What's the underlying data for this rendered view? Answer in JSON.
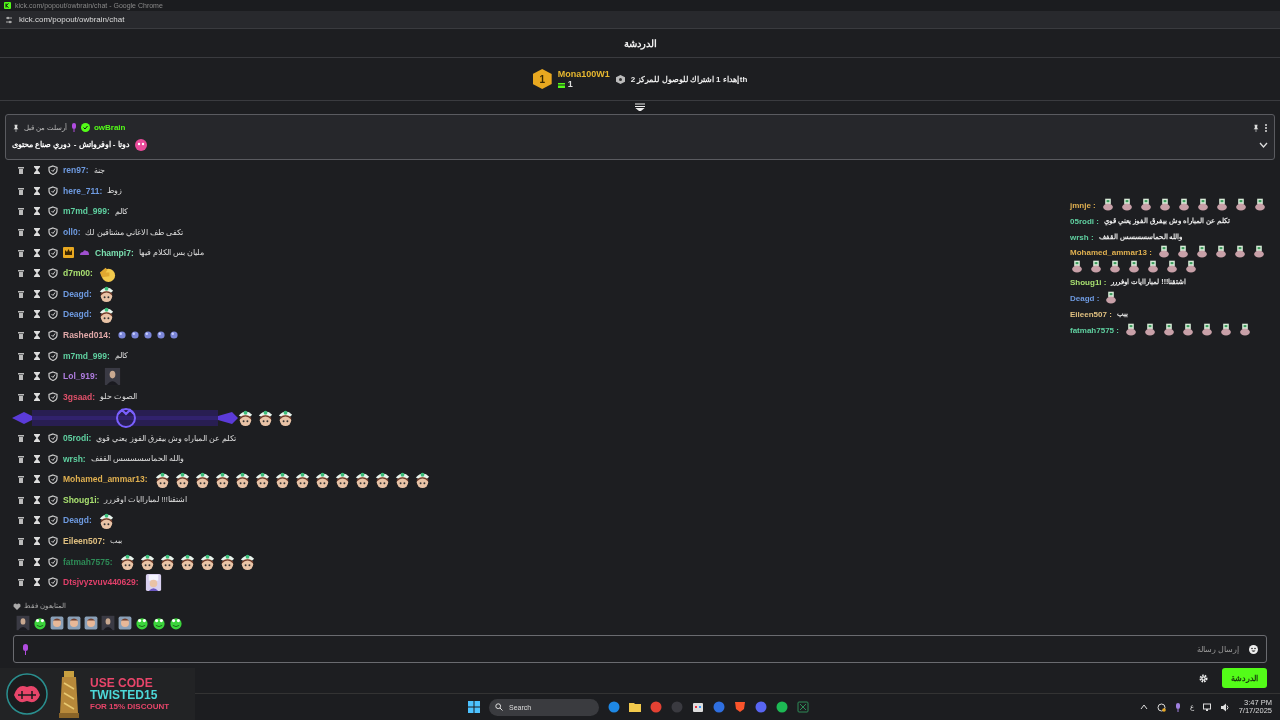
{
  "browser": {
    "title": "kick.com/popout/owbrain/chat - Google Chrome",
    "url": "kick.com/popout/owbrain/chat"
  },
  "chat_header": {
    "title": "الدردشة"
  },
  "gift_leaderboard": {
    "rank": "1",
    "user": "Mona100W1",
    "count": "1",
    "prompt": "إهداء 1 اشتراك للوصول للمركز 2",
    "suffix": "th"
  },
  "pinned": {
    "label": "أرسلت من قبل",
    "sender": "owBrain",
    "message": "دوتا - اوفرواتش - دوري صناع محتوى"
  },
  "messages": [
    {
      "user": "ren97:",
      "color": "#6e9ae0",
      "text": "جنة"
    },
    {
      "user": "here_711:",
      "color": "#6e9ae0",
      "text": "زوط"
    },
    {
      "user": "m7md_999:",
      "color": "#5fd0a0",
      "text": "كالم"
    },
    {
      "user": "oll0:",
      "color": "#6e9ae0",
      "text": "تكفى طف الاغاني مشتاقين لك"
    },
    {
      "user": "Champi7:",
      "color": "#7be0b0",
      "badges": [
        {
          "kind": "crown"
        },
        {
          "kind": "cloud"
        }
      ],
      "text": "مليان بس الكلام فيها"
    },
    {
      "user": "d7m00:",
      "color": "#a8e070",
      "emotes": [
        {
          "kind": "thumb"
        }
      ]
    },
    {
      "user": "Deagd:",
      "color": "#6e9ae0",
      "emotes": [
        {
          "kind": "sticker"
        }
      ]
    },
    {
      "user": "Deagd:",
      "color": "#6e9ae0",
      "emotes": [
        {
          "kind": "sticker"
        }
      ]
    },
    {
      "user": "Rashed014:",
      "color": "#e0a8a8",
      "emotes": [
        {
          "kind": "orb"
        },
        {
          "kind": "orb"
        },
        {
          "kind": "orb"
        },
        {
          "kind": "orb"
        },
        {
          "kind": "orb"
        }
      ]
    },
    {
      "user": "m7md_999:",
      "color": "#5fd0a0",
      "text": "كالم"
    },
    {
      "user": "Lol_919:",
      "color": "#b07de0",
      "emotes": [
        {
          "kind": "portrait"
        }
      ]
    },
    {
      "user": "3gsaad:",
      "color": "#e0506a",
      "text": "الصوت حلو"
    },
    {
      "covered": true,
      "emotes": [
        {
          "kind": "sticker"
        },
        {
          "kind": "sticker"
        },
        {
          "kind": "sticker"
        }
      ]
    },
    {
      "user": "05rodi:",
      "color": "#5fd0a0",
      "text": "تكلم عن المباراه وش بيفرق الفوز يعني قوي"
    },
    {
      "user": "wrsh:",
      "color": "#5fd0a0",
      "text": "والله الحماسسسسس القفف"
    },
    {
      "user": "Mohamed_ammar13:",
      "color": "#e0b050",
      "emotes": [
        {
          "kind": "sticker"
        },
        {
          "kind": "sticker"
        },
        {
          "kind": "sticker"
        },
        {
          "kind": "sticker"
        },
        {
          "kind": "sticker"
        },
        {
          "kind": "sticker"
        },
        {
          "kind": "sticker"
        },
        {
          "kind": "sticker"
        },
        {
          "kind": "sticker"
        },
        {
          "kind": "sticker"
        },
        {
          "kind": "sticker"
        },
        {
          "kind": "sticker"
        },
        {
          "kind": "sticker"
        },
        {
          "kind": "sticker"
        }
      ]
    },
    {
      "user": "Shoug1i:",
      "color": "#a8e070",
      "text": "اشتقنا!!! لمباراايات اوفررر"
    },
    {
      "user": "Deagd:",
      "color": "#6e9ae0",
      "emotes": [
        {
          "kind": "sticker"
        }
      ]
    },
    {
      "user": "Eileen507:",
      "color": "#e0c080",
      "text": "ببب"
    },
    {
      "user": "fatmah7575:",
      "color": "#2e8b57",
      "emotes": [
        {
          "kind": "sticker"
        },
        {
          "kind": "sticker"
        },
        {
          "kind": "sticker"
        },
        {
          "kind": "sticker"
        },
        {
          "kind": "sticker"
        },
        {
          "kind": "sticker"
        },
        {
          "kind": "sticker"
        }
      ]
    },
    {
      "user": "Dtsjvyzvuv440629:",
      "color": "#e0406a",
      "emotes": [
        {
          "kind": "character"
        }
      ]
    }
  ],
  "followers_only": {
    "label": "المتابعون فقط"
  },
  "emote_bar": [
    {
      "kind": "portrait"
    },
    {
      "kind": "frog"
    },
    {
      "kind": "face"
    },
    {
      "kind": "face"
    },
    {
      "kind": "face"
    },
    {
      "kind": "portrait"
    },
    {
      "kind": "face"
    },
    {
      "kind": "frog"
    },
    {
      "kind": "frog"
    },
    {
      "kind": "frog"
    }
  ],
  "composer": {
    "placeholder": "إرسال رسالة",
    "send_label": "الدردشة"
  },
  "overlay_chat": [
    {
      "user": "jmnje :",
      "color": "#e0b050",
      "emotes": [
        {
          "kind": "mini"
        },
        {
          "kind": "mini"
        },
        {
          "kind": "mini"
        },
        {
          "kind": "mini"
        },
        {
          "kind": "mini"
        },
        {
          "kind": "mini"
        },
        {
          "kind": "mini"
        },
        {
          "kind": "mini"
        },
        {
          "kind": "mini"
        }
      ]
    },
    {
      "user": "05rodi :",
      "color": "#5fd0a0",
      "text": "تكلم عن المباراه وش بيفرق الفوز يعني قوي"
    },
    {
      "user": "wrsh :",
      "color": "#5fd0a0",
      "text": "والله الحماسسسسس القفف"
    },
    {
      "user": "Mohamed_ammar13 :",
      "color": "#e0b050",
      "emotes": [
        {
          "kind": "mini"
        },
        {
          "kind": "mini"
        },
        {
          "kind": "mini"
        },
        {
          "kind": "mini"
        },
        {
          "kind": "mini"
        },
        {
          "kind": "mini"
        },
        {
          "kind": "mini"
        },
        {
          "kind": "mini"
        },
        {
          "kind": "mini"
        },
        {
          "kind": "mini"
        },
        {
          "kind": "mini"
        },
        {
          "kind": "mini"
        },
        {
          "kind": "mini"
        }
      ]
    },
    {
      "user": "Shoug1i :",
      "color": "#a8e070",
      "text": "اشتقنا!!! لمباراايات اوفررر"
    },
    {
      "user": "Deagd :",
      "color": "#6e9ae0",
      "emotes": [
        {
          "kind": "mini"
        }
      ]
    },
    {
      "user": "Eileen507 :",
      "color": "#e0c080",
      "text": "ببب"
    },
    {
      "user": "fatmah7575 :",
      "color": "#5fd0a0",
      "emotes": [
        {
          "kind": "mini"
        },
        {
          "kind": "mini"
        },
        {
          "kind": "mini"
        },
        {
          "kind": "mini"
        },
        {
          "kind": "mini"
        },
        {
          "kind": "mini"
        },
        {
          "kind": "mini"
        }
      ]
    }
  ],
  "ad": {
    "line1": "USE CODE",
    "line2": "TWISTED15",
    "line3": "FOR 15% DISCOUNT"
  },
  "taskbar": {
    "search": "Search",
    "language": "ع",
    "time": "3:47 PM",
    "date": "7/17/2025"
  }
}
